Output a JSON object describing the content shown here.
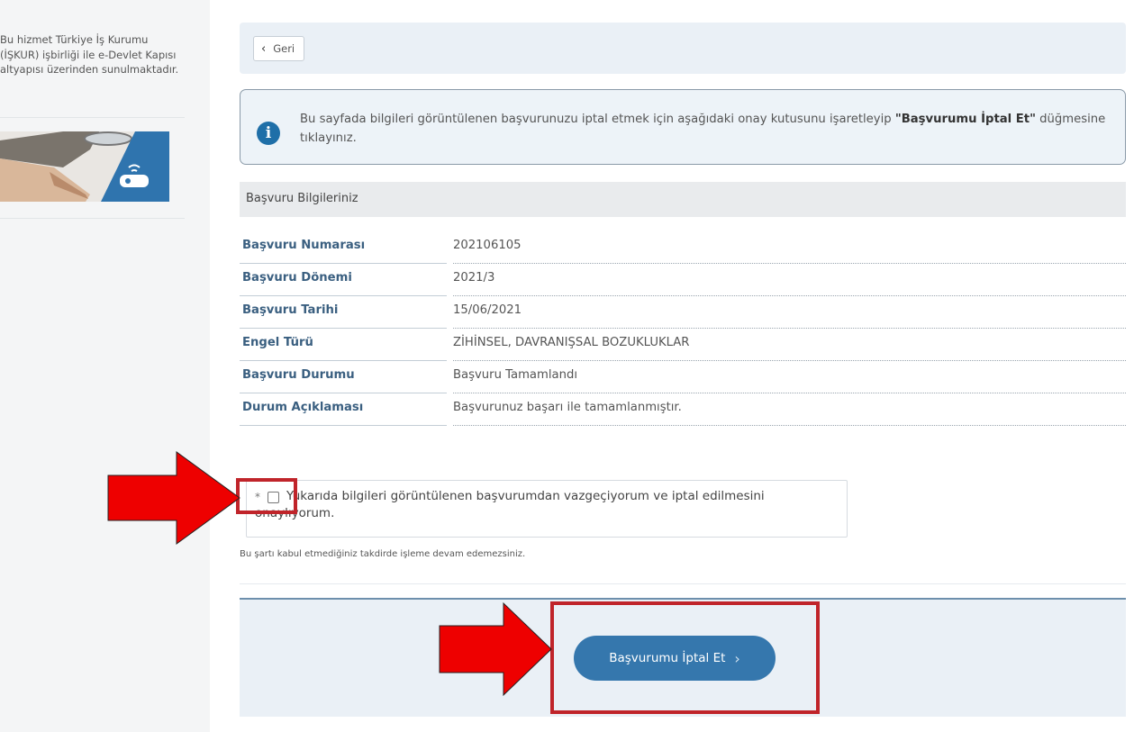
{
  "sidebar": {
    "description": "Bu hizmet Türkiye İş Kurumu (İŞKUR) işbirliği ile e-Devlet Kapısı altyapısı üzerinden sunulmaktadır."
  },
  "nav": {
    "back_label": "Geri"
  },
  "info": {
    "text_before": "Bu sayfada bilgileri görüntülenen başvurunuzu iptal etmek için aşağıdaki onay kutusunu işaretleyip ",
    "text_bold": "\"Başvurumu İptal Et\"",
    "text_after": " düğmesine tıklayınız."
  },
  "section": {
    "title": "Başvuru Bilgileriniz"
  },
  "details": [
    {
      "label": "Başvuru Numarası",
      "value": "202106105"
    },
    {
      "label": "Başvuru Dönemi",
      "value": "2021/3"
    },
    {
      "label": "Başvuru Tarihi",
      "value": "15/06/2021"
    },
    {
      "label": "Engel Türü",
      "value": "ZİHİNSEL, DAVRANIŞSAL BOZUKLUKLAR"
    },
    {
      "label": "Başvuru Durumu",
      "value": "Başvuru Tamamlandı"
    },
    {
      "label": "Durum Açıklaması",
      "value": "Başvurunuz başarı ile tamamlanmıştır."
    }
  ],
  "confirm": {
    "required_mark": "*",
    "label": "Yukarıda bilgileri görüntülenen başvurumdan vazgeçiyorum ve iptal edilmesini onaylıyorum.",
    "hint": "Bu şartı kabul etmediğiniz takdirde işleme devam edemezsiniz."
  },
  "actions": {
    "cancel_label": "Başvurumu İptal Et"
  },
  "colors": {
    "primary": "#3577ad",
    "annotation": "#c0242a",
    "arrow": "#ee0000"
  }
}
